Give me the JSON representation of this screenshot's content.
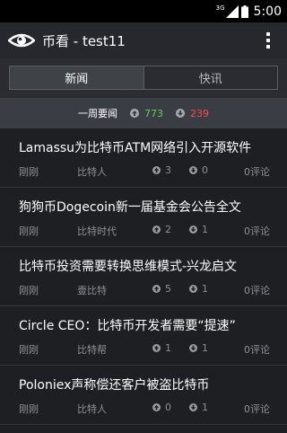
{
  "status_bar": {
    "network": "3G",
    "clock": "5:00"
  },
  "action_bar": {
    "title": "币看 - test11"
  },
  "tabs": [
    {
      "label": "新闻",
      "active": true
    },
    {
      "label": "快讯",
      "active": false
    }
  ],
  "weekly": {
    "label": "一周要闻",
    "up_count": "773",
    "down_count": "239"
  },
  "articles": [
    {
      "title": "Lamassu为比特币ATM网络引入开源软件",
      "time": "刚刚",
      "source": "比特人",
      "up": "3",
      "down": "0",
      "comments": "0评论"
    },
    {
      "title": "狗狗币Dogecoin新一届基金会公告全文",
      "time": "刚刚",
      "source": "比特时代",
      "up": "2",
      "down": "1",
      "comments": "0评论"
    },
    {
      "title": "比特币投资需要转换思维模式-兴龙启文",
      "time": "刚刚",
      "source": "壹比特",
      "up": "5",
      "down": "1",
      "comments": "0评论"
    },
    {
      "title": "Circle CEO：比特币开发者需要“提速”",
      "time": "刚刚",
      "source": "比特帮",
      "up": "1",
      "down": "1",
      "comments": "0评论"
    },
    {
      "title": "Poloniex声称偿还客户被盗比特币",
      "time": "刚刚",
      "source": "比特人",
      "up": "0",
      "down": "1",
      "comments": "0评论"
    }
  ],
  "colors": {
    "up": "#5fd05a",
    "down": "#ff4a4a",
    "meta": "#8e9095"
  }
}
